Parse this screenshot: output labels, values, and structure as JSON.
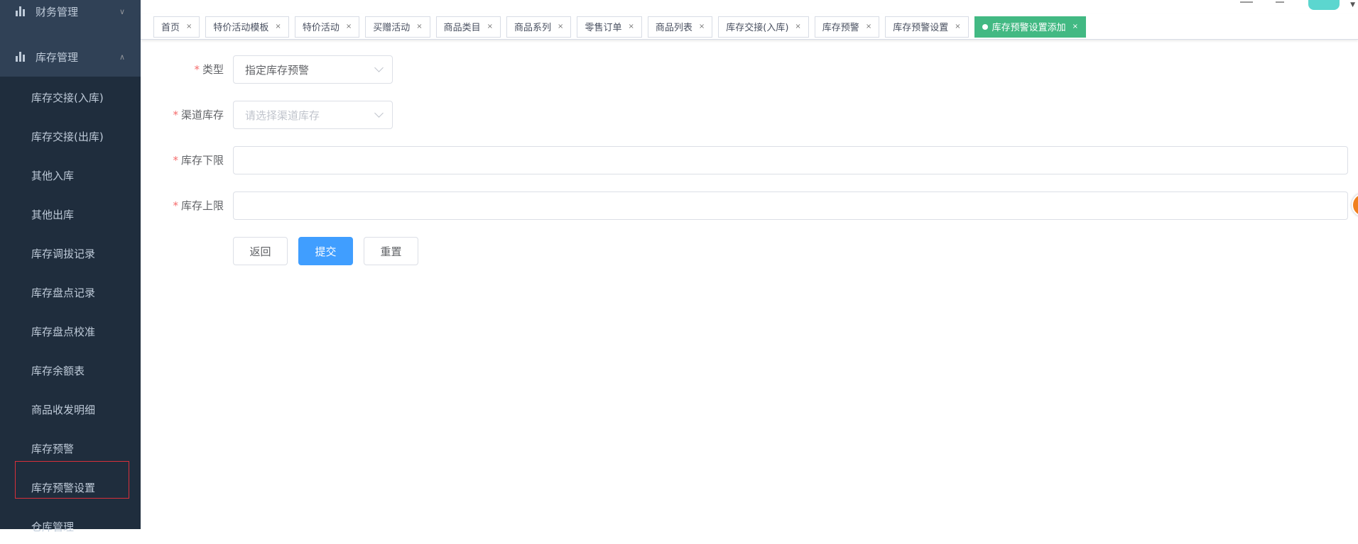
{
  "sidebar": {
    "groups": [
      {
        "label": "财务管理",
        "icon": "bar-chart-icon",
        "expanded": false
      },
      {
        "label": "库存管理",
        "icon": "bar-chart-icon",
        "expanded": true
      }
    ],
    "items": [
      "库存交接(入库)",
      "库存交接(出库)",
      "其他入库",
      "其他出库",
      "库存调拔记录",
      "库存盘点记录",
      "库存盘点校准",
      "库存余额表",
      "商品收发明细",
      "库存预警",
      "库存预警设置",
      "仓库管理"
    ]
  },
  "tabs": [
    "首页",
    "特价活动模板",
    "特价活动",
    "买赠活动",
    "商品类目",
    "商品系列",
    "零售订单",
    "商品列表",
    "库存交接(入库)",
    "库存预警",
    "库存预警设置",
    "库存预警设置添加"
  ],
  "form": {
    "type_label": "类型",
    "type_value": "指定库存预警",
    "channel_label": "渠道库存",
    "channel_placeholder": "请选择渠道库存",
    "min_label": "库存下限",
    "min_value": "",
    "max_label": "库存上限",
    "max_value": "",
    "required_mark": "*"
  },
  "buttons": {
    "back": "返回",
    "submit": "提交",
    "reset": "重置"
  },
  "colors": {
    "sidebar": "#304156",
    "submenu": "#1f2d3d",
    "active_tab": "#42b983",
    "primary": "#409eff"
  }
}
